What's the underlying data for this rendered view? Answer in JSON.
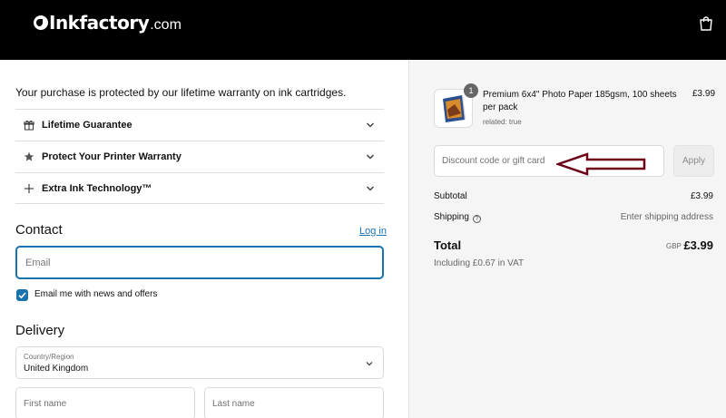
{
  "header": {
    "logo_name": "Inkfactory",
    "logo_tld": ".com"
  },
  "checkout": {
    "warranty_text": "Your purchase is protected by our lifetime warranty on ink cartridges.",
    "accordion": [
      {
        "label": "Lifetime Guarantee",
        "icon": "gift-icon"
      },
      {
        "label": "Protect Your Printer Warranty",
        "icon": "star-icon"
      },
      {
        "label": "Extra Ink Technology™",
        "icon": "plus-icon"
      }
    ],
    "contact": {
      "heading": "Contact",
      "login_link": "Log in",
      "email_placeholder": "Email",
      "newsletter_label": "Email me with news and offers",
      "newsletter_checked": true
    },
    "delivery": {
      "heading": "Delivery",
      "country_label": "Country/Region",
      "country_value": "United Kingdom",
      "first_name_placeholder": "First name",
      "last_name_placeholder": "Last name"
    }
  },
  "summary": {
    "product": {
      "quantity": "1",
      "name": "Premium 6x4\" Photo Paper 185gsm, 100 sheets per pack",
      "meta": "related: true",
      "price": "£3.99"
    },
    "discount_placeholder": "Discount code or gift card",
    "apply_label": "Apply",
    "subtotal_label": "Subtotal",
    "subtotal_value": "£3.99",
    "shipping_label": "Shipping",
    "shipping_value": "Enter shipping address",
    "total_label": "Total",
    "currency": "GBP",
    "total_value": "£3.99",
    "vat_note": "Including £0.67 in VAT",
    "colors": {
      "accent": "#1773b0",
      "arrow": "#6b0016"
    }
  }
}
